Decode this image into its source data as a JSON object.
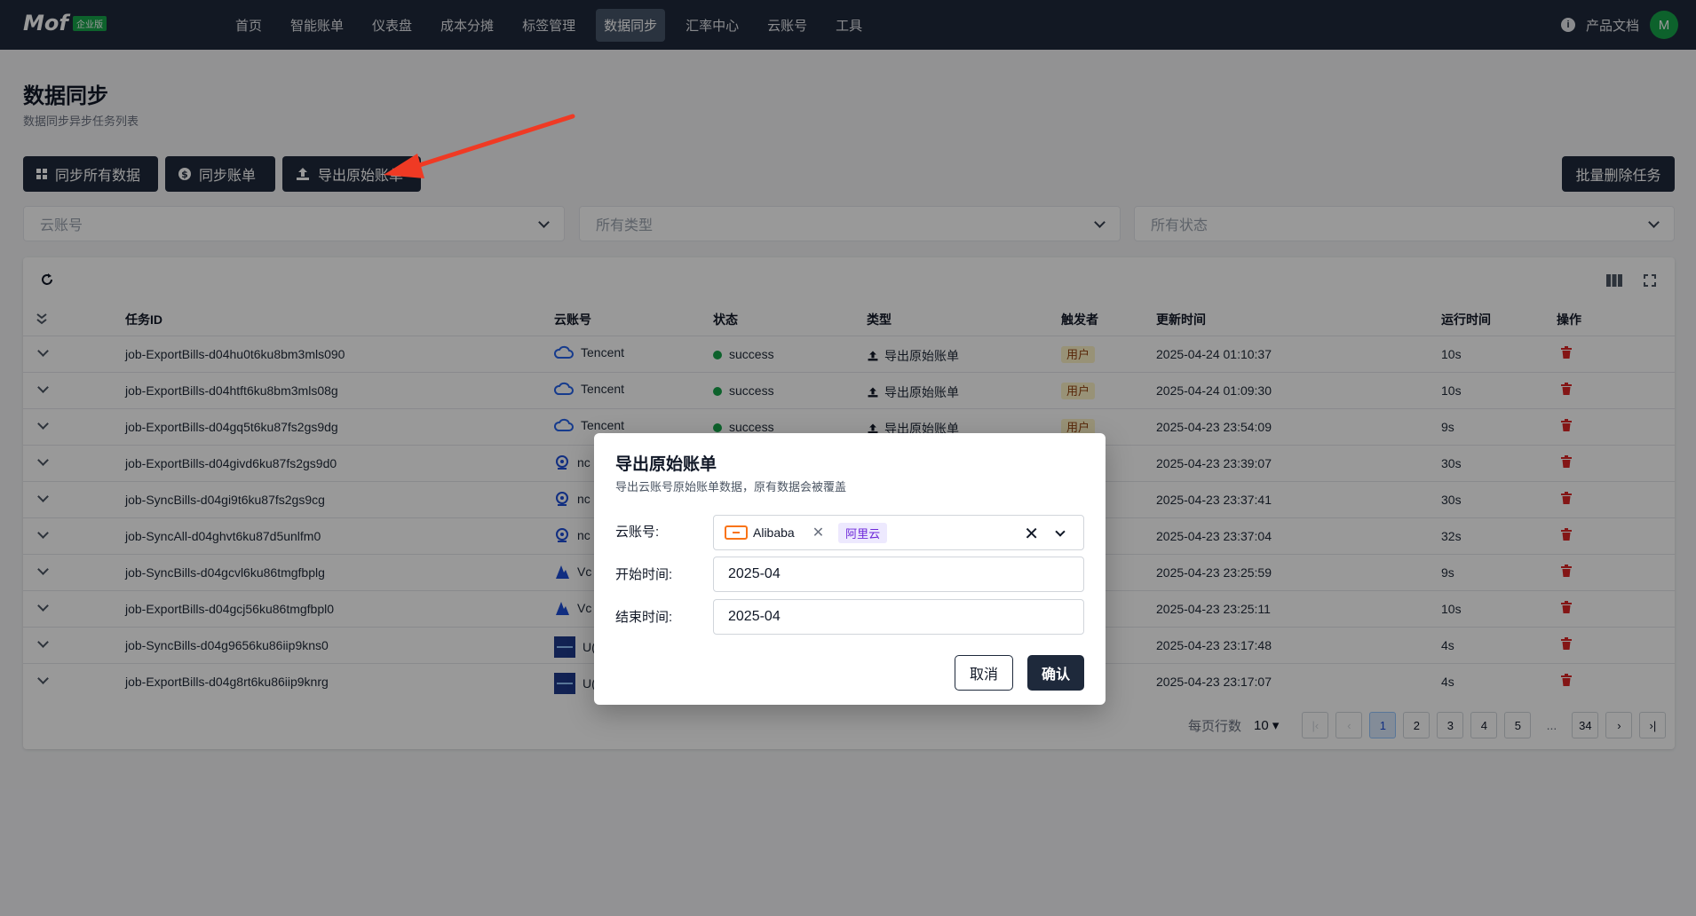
{
  "app": {
    "logo": "Mof",
    "edition": "企业版"
  },
  "nav": {
    "items": [
      "首页",
      "智能账单",
      "仪表盘",
      "成本分摊",
      "标签管理",
      "数据同步",
      "汇率中心",
      "云账号",
      "工具"
    ],
    "active_index": 5,
    "docs": "产品文档",
    "avatar": "M"
  },
  "page": {
    "title": "数据同步",
    "subtitle": "数据同步异步任务列表"
  },
  "actions": {
    "sync_all": "同步所有数据",
    "sync_bills": "同步账单",
    "export_raw": "导出原始账单",
    "batch_delete": "批量删除任务"
  },
  "filters": {
    "account": "云账号",
    "type": "所有类型",
    "status": "所有状态"
  },
  "table": {
    "headers": [
      "任务ID",
      "云账号",
      "状态",
      "类型",
      "触发者",
      "更新时间",
      "运行时间",
      "操作"
    ],
    "rows": [
      {
        "id": "job-ExportBills-d04hu0t6ku8bm3mls090",
        "account": "Tencent",
        "status": "success",
        "type": "导出原始账单",
        "trigger": "用户",
        "updated": "2025-04-24 01:10:37",
        "runtime": "10s",
        "icon": "cloud-icon"
      },
      {
        "id": "job-ExportBills-d04htft6ku8bm3mls08g",
        "account": "Tencent",
        "status": "success",
        "type": "导出原始账单",
        "trigger": "用户",
        "updated": "2025-04-24 01:09:30",
        "runtime": "10s",
        "icon": "cloud-icon"
      },
      {
        "id": "job-ExportBills-d04gq5t6ku87fs2gs9dg",
        "account": "Tencent",
        "status": "success",
        "type": "导出原始账单",
        "trigger": "用户",
        "updated": "2025-04-23 23:54:09",
        "runtime": "9s",
        "icon": "cloud-icon"
      },
      {
        "id": "job-ExportBills-d04givd6ku87fs2gs9d0",
        "account": "nc",
        "status": "",
        "type": "",
        "trigger": "",
        "updated": "2025-04-23 23:39:07",
        "runtime": "30s",
        "icon": "swirl-icon"
      },
      {
        "id": "job-SyncBills-d04gi9t6ku87fs2gs9cg",
        "account": "nc",
        "status": "",
        "type": "",
        "trigger": "",
        "updated": "2025-04-23 23:37:41",
        "runtime": "30s",
        "icon": "swirl-icon"
      },
      {
        "id": "job-SyncAll-d04ghvt6ku87d5unlfm0",
        "account": "nc",
        "status": "",
        "type": "",
        "trigger": "",
        "updated": "2025-04-23 23:37:04",
        "runtime": "32s",
        "icon": "swirl-icon"
      },
      {
        "id": "job-SyncBills-d04gcvl6ku86tmgfbplg",
        "account": "Vc",
        "status": "",
        "type": "",
        "trigger": "",
        "updated": "2025-04-23 23:25:59",
        "runtime": "9s",
        "icon": "mountain-icon"
      },
      {
        "id": "job-ExportBills-d04gcj56ku86tmgfbpl0",
        "account": "Vc",
        "status": "",
        "type": "",
        "trigger": "",
        "updated": "2025-04-23 23:25:11",
        "runtime": "10s",
        "icon": "mountain-icon"
      },
      {
        "id": "job-SyncBills-d04g9656ku86iip9kns0",
        "account": "U(",
        "status": "",
        "type": "",
        "trigger": "",
        "updated": "2025-04-23 23:17:48",
        "runtime": "4s",
        "icon": "ucloud-icon"
      },
      {
        "id": "job-ExportBills-d04g8rt6ku86iip9knrg",
        "account": "U(",
        "status": "",
        "type": "",
        "trigger": "",
        "updated": "2025-04-23 23:17:07",
        "runtime": "4s",
        "icon": "ucloud-icon"
      }
    ]
  },
  "pagination": {
    "rows_per_page_label": "每页行数",
    "rows_per_page": "10",
    "pages": [
      "1",
      "2",
      "3",
      "4",
      "5",
      "...",
      "34"
    ],
    "current": "1"
  },
  "modal": {
    "title": "导出原始账单",
    "subtitle": "导出云账号原始账单数据，原有数据会被覆盖",
    "account_label": "云账号:",
    "account_chip": "Alibaba",
    "account_tag": "阿里云",
    "start_label": "开始时间:",
    "start_value": "2025-04",
    "end_label": "结束时间:",
    "end_value": "2025-04",
    "cancel": "取消",
    "confirm": "确认"
  },
  "colors": {
    "nav_bg": "#1e293b",
    "accent_green": "#16a34a",
    "danger": "#dc2626",
    "arrow": "#ef3a24"
  }
}
